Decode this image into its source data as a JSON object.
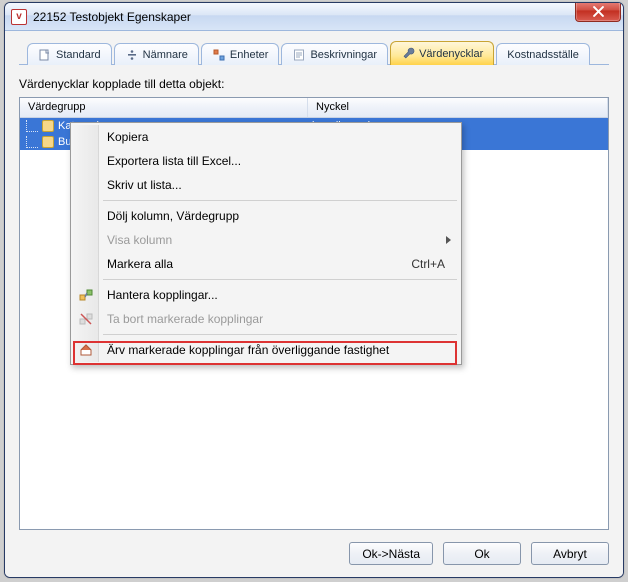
{
  "window": {
    "title": "22152 Testobjekt Egenskaper"
  },
  "tabs": {
    "standard": "Standard",
    "namnare": "Nämnare",
    "enheter": "Enheter",
    "beskrivningar": "Beskrivningar",
    "vardenycklar": "Värdenycklar",
    "kostnadsstalle": "Kostnadsställe"
  },
  "section_label": "Värdenycklar kopplade till detta objekt:",
  "table": {
    "headers": {
      "group": "Värdegrupp",
      "key": "Nyckel"
    },
    "rows": [
      {
        "group": "Kategori",
        "key": "koppling saknas"
      },
      {
        "group": "Budget",
        "key": ""
      }
    ]
  },
  "context_menu": {
    "kopiera": "Kopiera",
    "export_excel": "Exportera lista till Excel...",
    "skriv_ut": "Skriv ut lista...",
    "dolj_kolumn": "Dölj kolumn, Värdegrupp",
    "visa_kolumn": "Visa kolumn",
    "markera_alla": "Markera alla",
    "markera_alla_shortcut": "Ctrl+A",
    "hantera_kopplingar": "Hantera kopplingar...",
    "ta_bort": "Ta bort markerade kopplingar",
    "arv_markerade": "Ärv markerade kopplingar från överliggande fastighet"
  },
  "buttons": {
    "ok_next": "Ok->Nästa",
    "ok": "Ok",
    "cancel": "Avbryt"
  }
}
